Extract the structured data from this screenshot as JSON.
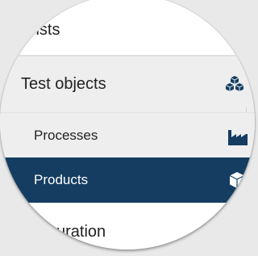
{
  "menu": {
    "top_item": {
      "label": "lists"
    },
    "test_objects": {
      "label": "Test objects",
      "icon": "boxes-stack-icon"
    },
    "processes": {
      "label": "Processes",
      "icon": "factory-icon"
    },
    "products": {
      "label": "Products",
      "icon": "cube-icon",
      "selected": true
    },
    "bottom_item": {
      "label": "uration"
    }
  },
  "colors": {
    "selected_background": "#143d61",
    "selected_text": "#ffffff",
    "group_background": "#eeeeee",
    "icon_color": "#143d61"
  }
}
